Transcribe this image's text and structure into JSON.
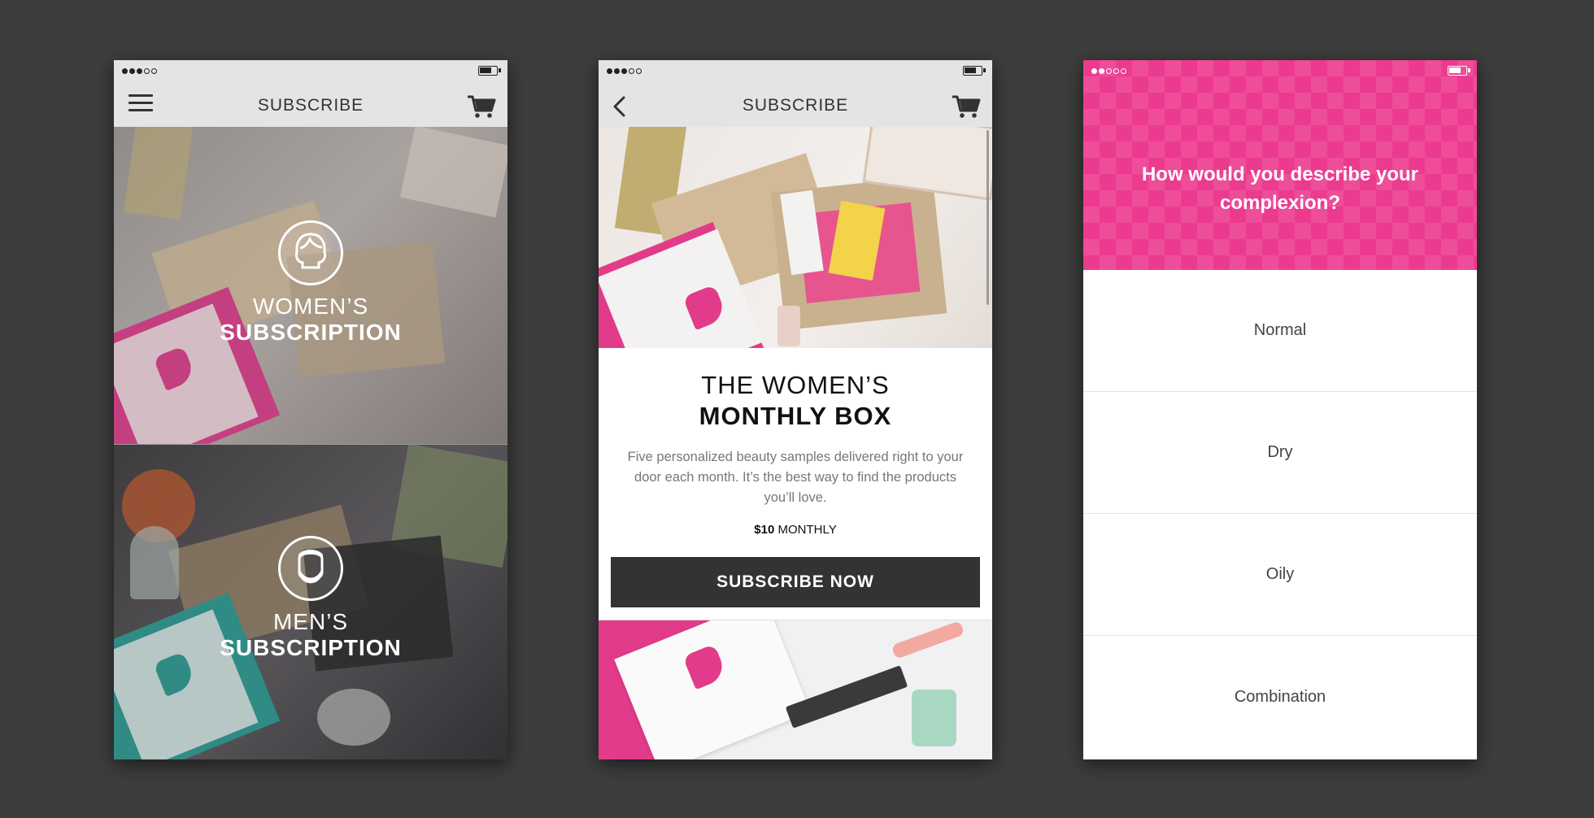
{
  "colors": {
    "accent": "#ec3b8f",
    "nav_bg": "#e4e4e6",
    "button_bg": "#333333"
  },
  "screen1": {
    "title": "SUBSCRIBE",
    "icons": {
      "menu": "hamburger-icon",
      "cart": "cart-icon"
    },
    "women": {
      "line1": "WOMEN’S",
      "line2": "SUBSCRIPTION",
      "icon": "woman-avatar-icon"
    },
    "men": {
      "line1": "MEN’S",
      "line2": "SUBSCRIPTION",
      "icon": "man-avatar-icon"
    }
  },
  "screen2": {
    "title": "SUBSCRIBE",
    "icons": {
      "back": "chevron-left-icon",
      "cart": "cart-icon"
    },
    "heading_line1": "THE WOMEN’S",
    "heading_line2": "MONTHLY BOX",
    "description": "Five personalized beauty samples delivered right to your door each month. It’s the best way to find the products you’ll love.",
    "price_amount": "$10",
    "price_period": "MONTHLY",
    "cta": "SUBSCRIBE NOW"
  },
  "screen3": {
    "question": "How would you describe your complexion?",
    "options": [
      "Normal",
      "Dry",
      "Oily",
      "Combination"
    ]
  }
}
